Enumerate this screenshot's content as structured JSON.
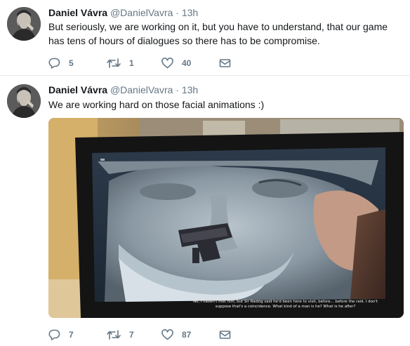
{
  "tweets": [
    {
      "author": {
        "name": "Daniel Vávra",
        "handle": "@DanielVavra",
        "separator": "·",
        "time": "13h"
      },
      "text": "But seriously, we are working on it, but you have to understand, that our game has tens of hours of dialogues so there has to be compromise.",
      "actions": {
        "replies": "5",
        "retweets": "1",
        "likes": "40"
      }
    },
    {
      "author": {
        "name": "Daniel Vávra",
        "handle": "@DanielVavra",
        "separator": "·",
        "time": "13h"
      },
      "text": "We are working hard on those facial animations :)",
      "media": {
        "subtitle": "No, I haven't met him, but Sir Radzig said he'd been here to visit, before... before the raid. I don't suppose that's a coincidence. What kind of a man is he? What is he after?"
      },
      "actions": {
        "replies": "7",
        "retweets": "7",
        "likes": "87"
      }
    }
  ],
  "colors": {
    "text": "#14171a",
    "muted": "#657786",
    "divider": "#e6ecf0"
  },
  "icons": [
    "reply-icon",
    "retweet-icon",
    "like-icon",
    "direct-message-icon"
  ]
}
